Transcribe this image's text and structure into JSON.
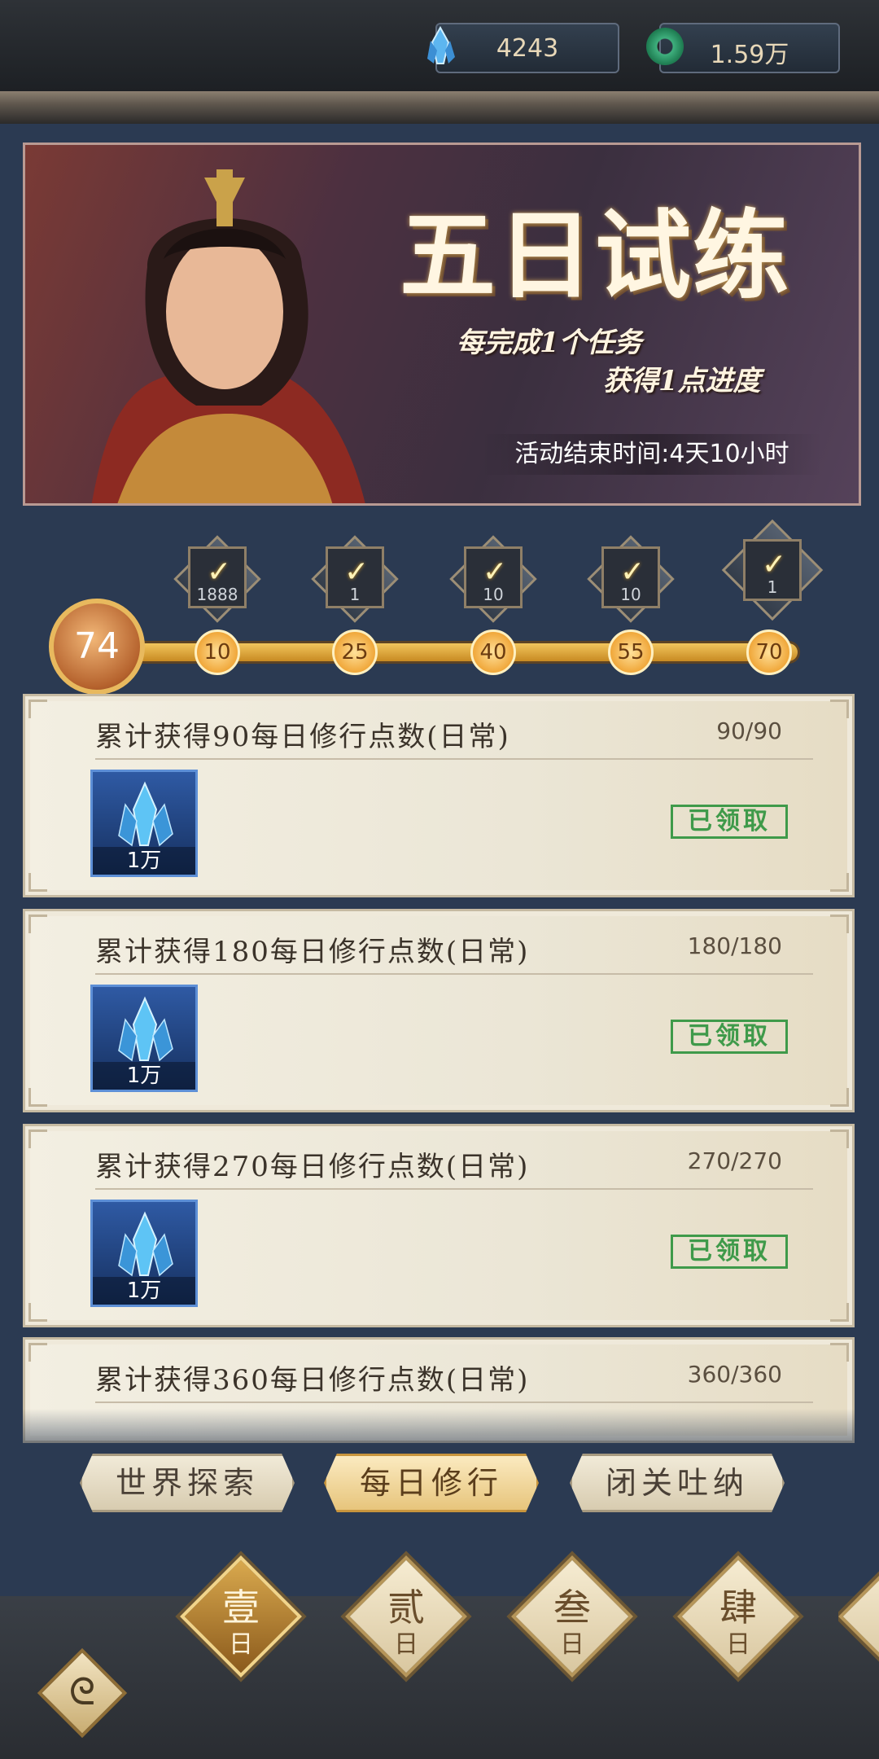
{
  "currencies": {
    "gems": "4243",
    "jade": "1.59万"
  },
  "banner": {
    "title": "五日试练",
    "sub1": "每完成1个任务",
    "sub2": "获得1点进度",
    "time": "活动结束时间:4天10小时"
  },
  "progress": {
    "level": "74",
    "nodes": [
      "10",
      "25",
      "40",
      "55",
      "70"
    ],
    "rewards": [
      "1888",
      "1",
      "10",
      "10",
      "1"
    ]
  },
  "tasks": [
    {
      "title": "累计获得90每日修行点数(日常)",
      "progress": "90/90",
      "reward_qty": "1万",
      "status": "已领取"
    },
    {
      "title": "累计获得180每日修行点数(日常)",
      "progress": "180/180",
      "reward_qty": "1万",
      "status": "已领取"
    },
    {
      "title": "累计获得270每日修行点数(日常)",
      "progress": "270/270",
      "reward_qty": "1万",
      "status": "已领取"
    },
    {
      "title": "累计获得360每日修行点数(日常)",
      "progress": "360/360"
    }
  ],
  "tabs": [
    "世界探索",
    "每日修行",
    "闭关吐纳"
  ],
  "days": [
    {
      "big": "壹",
      "small": "日"
    },
    {
      "big": "贰",
      "small": "日"
    },
    {
      "big": "叁",
      "small": "日"
    },
    {
      "big": "肆",
      "small": "日"
    }
  ]
}
